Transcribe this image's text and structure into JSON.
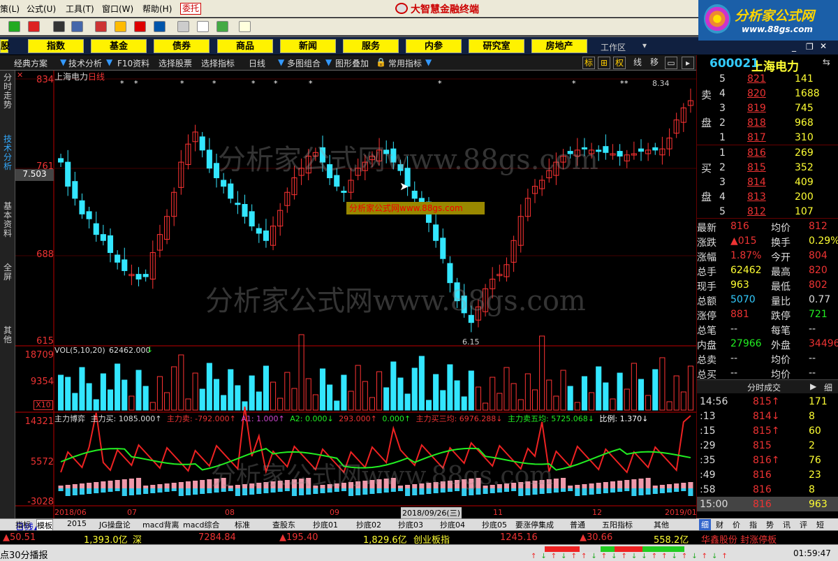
{
  "menu": {
    "items": [
      "策(L)",
      "公式(U)",
      "工具(T)",
      "窗口(W)",
      "帮助(H)"
    ],
    "entrust": "委托",
    "app_title": "大智慧金融终端"
  },
  "logo": {
    "text": "分析家公式网",
    "url": "www.88gs.com"
  },
  "nav": {
    "buttons": [
      "股",
      "指数",
      "基金",
      "债券",
      "商品",
      "新闻",
      "服务",
      "内参",
      "研究室",
      "房地产"
    ],
    "workarea": "工作区"
  },
  "tabs2": {
    "items": [
      "经典方案",
      "技术分析",
      "F10资料",
      "选择股票",
      "选择指标",
      "日线",
      "多图组合",
      "图形叠加",
      "常用指标"
    ],
    "right_buttons": [
      "标",
      "⊞",
      "权",
      "线",
      "移"
    ]
  },
  "left_nav": [
    "分时走势",
    "技术分析",
    "基本资料",
    "全屏",
    "其他"
  ],
  "chart": {
    "stock_label": "上海电力",
    "period_label": "日线",
    "price_ticks": [
      "834",
      "761",
      "688",
      "615"
    ],
    "current_price_tag": "7.503",
    "high_label": "8.34",
    "low_label": "6.15",
    "watermark": "分析家公式网www.88gs.com",
    "watermark2": "分析家公式网www.88gs.com",
    "watermark3": "分析家公式网www.88gs.com",
    "cursor_box": "分析家公式网www.88gs.com",
    "vol_header": "VOL(5,10,20)",
    "vol_value": "62462.000",
    "vol_ticks": [
      "18709",
      "9354",
      "X10"
    ],
    "ind_header": "主力博弈",
    "ind_vals": [
      "主力买: 1085.000↑",
      "主力卖: -792.000↑",
      "A1: 1.000↑",
      "A2: 0.000↓",
      "293.000↑",
      "0.000↑",
      "主力买三均: 6976.288↓",
      "主力卖五均: 5725.068↓",
      "比例: 1.370↓"
    ],
    "ind_ticks": [
      "14321",
      "5572",
      "-3028"
    ],
    "date_labels": [
      "2018/06",
      "07",
      "08",
      "09",
      "10",
      "11",
      "12",
      "2019/01"
    ],
    "date_cursor": "2018/09/26(三)"
  },
  "chart_data": {
    "type": "candlestick",
    "ylim": [
      615,
      834
    ],
    "high": 834,
    "low": 615,
    "close_series_approx": [
      765,
      745,
      735,
      722,
      718,
      705,
      700,
      690,
      682,
      675,
      672,
      668,
      670,
      690,
      705,
      720,
      740,
      765,
      780,
      790,
      775,
      760,
      752,
      745,
      735,
      730,
      720,
      712,
      706,
      700,
      712,
      725,
      740,
      752,
      760,
      770,
      773,
      765,
      752,
      745,
      740,
      750,
      760,
      765,
      770,
      775,
      772,
      765,
      758,
      745,
      735,
      728,
      715,
      700,
      685,
      665,
      650,
      640,
      632,
      645,
      660,
      668,
      672,
      680,
      700,
      720,
      735,
      745,
      750,
      758,
      765,
      770,
      772,
      775,
      776,
      775,
      774,
      773,
      772,
      770,
      771,
      772,
      774,
      775,
      775,
      776,
      785,
      800,
      810,
      816
    ]
  },
  "quote": {
    "code": "600021",
    "name": "上海电力",
    "sell_label": [
      "卖",
      "盘"
    ],
    "buy_label": [
      "买",
      "盘"
    ],
    "asks": [
      {
        "lvl": "5",
        "price": "821",
        "vol": "141"
      },
      {
        "lvl": "4",
        "price": "820",
        "vol": "1688"
      },
      {
        "lvl": "3",
        "price": "819",
        "vol": "745"
      },
      {
        "lvl": "2",
        "price": "818",
        "vol": "968"
      },
      {
        "lvl": "1",
        "price": "817",
        "vol": "310"
      }
    ],
    "bids": [
      {
        "lvl": "1",
        "price": "816",
        "vol": "269"
      },
      {
        "lvl": "2",
        "price": "815",
        "vol": "352"
      },
      {
        "lvl": "3",
        "price": "814",
        "vol": "409"
      },
      {
        "lvl": "4",
        "price": "813",
        "vol": "200"
      },
      {
        "lvl": "5",
        "price": "812",
        "vol": "107"
      }
    ],
    "stats": [
      [
        "最新",
        "816",
        "均价",
        "812"
      ],
      [
        "涨跌",
        "▲015",
        "换手",
        "0.29%"
      ],
      [
        "涨幅",
        "1.87%",
        "今开",
        "804"
      ],
      [
        "总手",
        "62462",
        "最高",
        "820"
      ],
      [
        "现手",
        "963",
        "最低",
        "802"
      ],
      [
        "总额",
        "5070",
        "量比",
        "0.77"
      ],
      [
        "涨停",
        "881",
        "跌停",
        "721"
      ],
      [
        "总笔",
        "--",
        "每笔",
        "--"
      ],
      [
        "内盘",
        "27966",
        "外盘",
        "34496"
      ],
      [
        "总卖",
        "--",
        "均价",
        "--"
      ],
      [
        "总买",
        "--",
        "均价",
        "--"
      ]
    ],
    "ticks_header": "分时成交",
    "ticks_btn": "细",
    "ticks": [
      [
        "14:56",
        "815↑",
        "171"
      ],
      [
        ":13",
        "814↓",
        "8"
      ],
      [
        ":15",
        "815↑",
        "60"
      ],
      [
        ":29",
        "815",
        "2"
      ],
      [
        ":35",
        "816↑",
        "76"
      ],
      [
        ":49",
        "816",
        "23"
      ],
      [
        ":58",
        "816",
        "8"
      ],
      [
        "15:00",
        "816",
        "963"
      ]
    ]
  },
  "bottom_tabs": [
    "日线▲",
    "指标",
    "模板",
    "2015",
    "JG操盘论",
    "macd背离",
    "macd综合",
    "标准",
    "查股东",
    "抄底01",
    "抄底02",
    "抄底03",
    "抄底04",
    "抄底05",
    "要涨停集成",
    "普通",
    "五阳指标",
    "其他"
  ],
  "right_tabs": [
    "细",
    "财",
    "价",
    "指",
    "势",
    "讯",
    "评",
    "短"
  ],
  "ticker": [
    "▲50.51",
    "1,393.0亿",
    "深",
    "7284.84",
    "▲195.40",
    "1,829.6亿",
    "创业板指",
    "1245.16",
    "▲30.66",
    "558.2亿",
    "华鑫股份 封涨停板"
  ],
  "status": {
    "left": "点30分播报",
    "time": "01:59:47"
  },
  "colors": {
    "up": "#ff3333",
    "down": "#33e6ff",
    "yellow": "#ffff00",
    "green": "#33ff33"
  }
}
